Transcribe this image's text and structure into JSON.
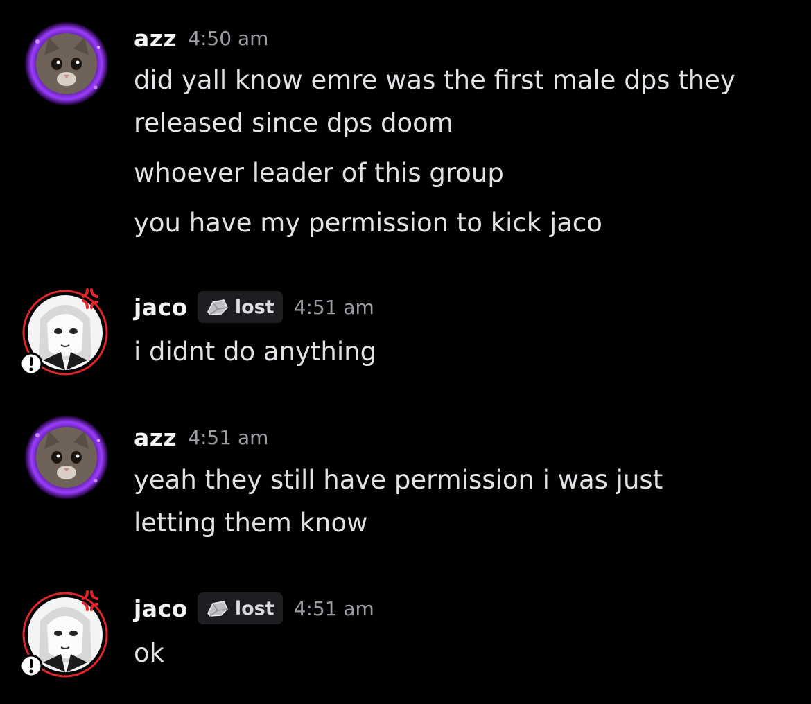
{
  "messages": [
    {
      "username": "azz",
      "time": "4:50 am",
      "lines": [
        "did yall know emre was the first male dps they",
        "released since dps doom",
        "whoever leader of this group",
        "you have my permission to kick jaco"
      ]
    },
    {
      "username": "jaco",
      "tag": "lost",
      "time": "4:51 am",
      "lines": [
        "i didnt do anything"
      ]
    },
    {
      "username": "azz",
      "time": "4:51 am",
      "lines": [
        "yeah they still have permission i was just",
        "letting them know"
      ]
    },
    {
      "username": "jaco",
      "tag": "lost",
      "time": "4:51 am",
      "lines": [
        "ok"
      ]
    }
  ],
  "icons": {
    "azz_avatar": "cat-avatar-icon",
    "jaco_avatar": "anime-girl-avatar-icon",
    "jaco_decoration": "anger-mark-icon",
    "jaco_status": "alert-badge-icon",
    "tag_icon": "stone-icon"
  },
  "colors": {
    "background": "#000000",
    "username": "#f2f3f5",
    "timestamp": "#9a9ca3",
    "message_text": "#e2e3e6",
    "tag_background": "#1d1e22",
    "azz_avatar_glow": "#9b3dff",
    "jaco_decoration_red": "#e0262b"
  }
}
